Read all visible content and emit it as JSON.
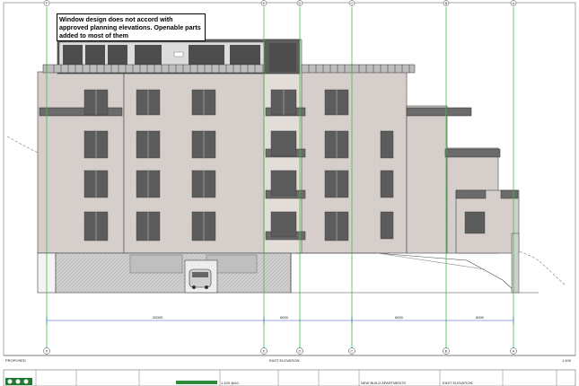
{
  "annotation": {
    "text": "Window design does not accord with approved planning elevations. Openable parts added to most of them"
  },
  "drawing": {
    "view_title": "EAST ELEVATION",
    "status_label": "PROPOSED",
    "scale_label": "1:100"
  },
  "grid_lines": [
    {
      "label": "F"
    },
    {
      "label": "E"
    },
    {
      "label": "D"
    },
    {
      "label": "C"
    },
    {
      "label": "B"
    },
    {
      "label": "A"
    }
  ],
  "dimensions": {
    "overall": "25000",
    "segment_1": "6000",
    "segment_2": "6000",
    "segment_3": "6000"
  },
  "title_block": {
    "project": "NEW BUILD APARTMENTS",
    "drawing_title": "EAST ELEVATION",
    "scale": "1:100 @A1"
  },
  "colors": {
    "facade": "#d6cfcb",
    "grid_line": "#3fbf3f",
    "window": "#5c5c5c",
    "logo": "#1f7a2e"
  }
}
